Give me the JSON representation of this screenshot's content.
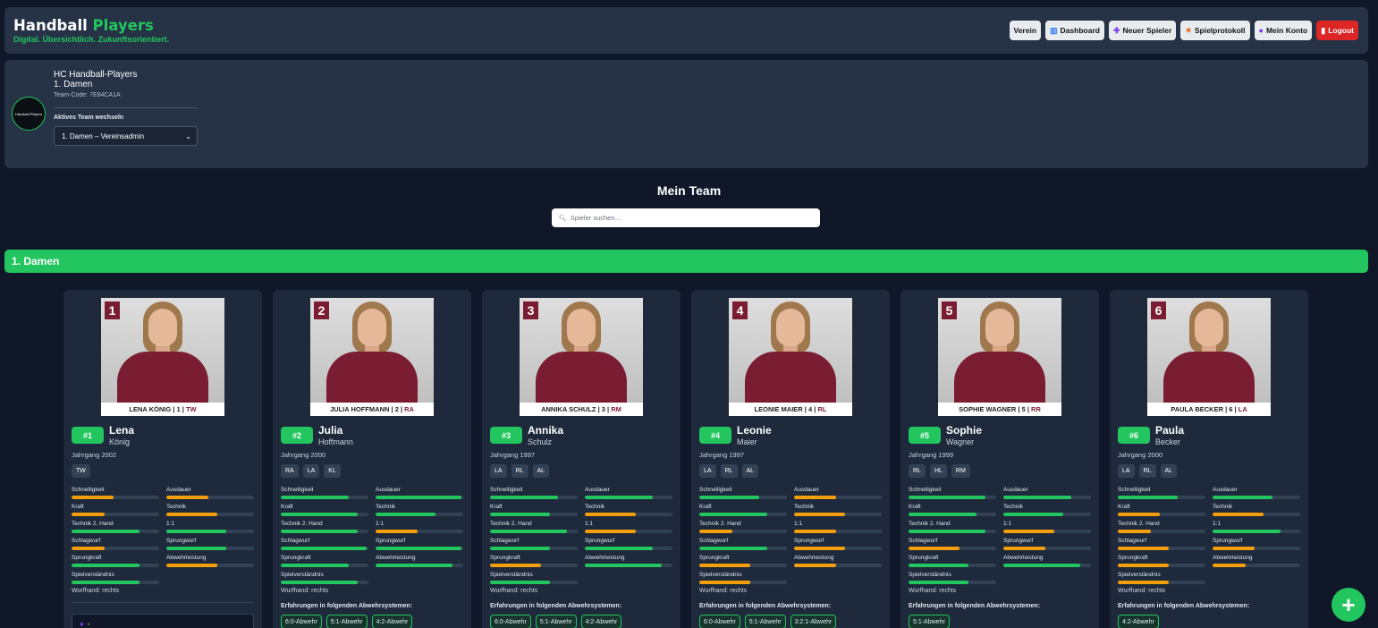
{
  "app": {
    "brand_main": "Handball",
    "brand_accent": "Players",
    "tagline": "Digital. Übersichtlich. Zukunftsorientiert."
  },
  "nav": {
    "verein": "Verein",
    "dashboard": "Dashboard",
    "new_player": "Neuer Spieler",
    "protocol": "Spielprotokoll",
    "account": "Mein Konto",
    "logout": "Logout"
  },
  "team": {
    "club": "HC Handball-Players",
    "name": "1. Damen",
    "code": "Team-Code: 7E84CA1A",
    "switch_label": "Aktives Team wechseln",
    "select_value": "1. Damen – Vereinsadmin",
    "logo_text": "Handball Players"
  },
  "page": {
    "title": "Mein Team",
    "search_placeholder": "Spieler suchen...",
    "group": "1. Damen",
    "fab": "+"
  },
  "stat_labels": [
    "Schnelligkeit",
    "Ausdauer",
    "Kraft",
    "Technik",
    "Technik 2. Hand",
    "1:1",
    "Schlagwurf",
    "Sprungwurf",
    "Sprungkraft",
    "Abwehrleistung",
    "Spielverständnis"
  ],
  "defense_title": "Erfahrungen in folgenden Abwehrsystemen:",
  "colors": {
    "green": "#22c55e",
    "orange": "#f59e0b",
    "maroon": "#7b1d32"
  },
  "players": [
    {
      "photo_num": "1",
      "caption_name": "LENA KÖNIG",
      "caption_num": "1",
      "caption_pos": "TW",
      "badge": "#1",
      "first": "Lena",
      "last": "König",
      "birth": "Jahrgang 2002",
      "tags": [
        "TW"
      ],
      "hand": "Wurfhand: rechts",
      "contact": "-",
      "defenses": [],
      "stats": [
        {
          "v": 0.48,
          "c": "orange"
        },
        {
          "v": 0.48,
          "c": "orange"
        },
        {
          "v": 0.38,
          "c": "orange"
        },
        {
          "v": 0.58,
          "c": "orange"
        },
        {
          "v": 0.78,
          "c": "green"
        },
        {
          "v": 0.68,
          "c": "green"
        },
        {
          "v": 0.38,
          "c": "orange"
        },
        {
          "v": 0.68,
          "c": "green"
        },
        {
          "v": 0.78,
          "c": "green"
        },
        {
          "v": 0.58,
          "c": "orange"
        },
        {
          "v": 0.78,
          "c": "green"
        }
      ]
    },
    {
      "photo_num": "2",
      "caption_name": "JULIA HOFFMANN",
      "caption_num": "2",
      "caption_pos": "RA",
      "badge": "#2",
      "first": "Julia",
      "last": "Hoffmann",
      "birth": "Jahrgang 2000",
      "tags": [
        "RA",
        "LA",
        "KL"
      ],
      "hand": "Wurfhand: rechts",
      "contact": "",
      "defenses": [
        "6:0-Abwehr",
        "5:1-Abwehr",
        "4:2-Abwehr"
      ],
      "stats": [
        {
          "v": 0.78,
          "c": "green"
        },
        {
          "v": 0.98,
          "c": "green"
        },
        {
          "v": 0.88,
          "c": "green"
        },
        {
          "v": 0.68,
          "c": "green"
        },
        {
          "v": 0.88,
          "c": "green"
        },
        {
          "v": 0.48,
          "c": "orange"
        },
        {
          "v": 0.98,
          "c": "green"
        },
        {
          "v": 0.98,
          "c": "green"
        },
        {
          "v": 0.78,
          "c": "green"
        },
        {
          "v": 0.88,
          "c": "green"
        },
        {
          "v": 0.88,
          "c": "green"
        }
      ]
    },
    {
      "photo_num": "3",
      "caption_name": "ANNIKA SCHULZ",
      "caption_num": "3",
      "caption_pos": "RM",
      "badge": "#3",
      "first": "Annika",
      "last": "Schulz",
      "birth": "Jahrgang 1997",
      "tags": [
        "LA",
        "RL",
        "AL"
      ],
      "hand": "Wurfhand: rechts",
      "contact": "",
      "defenses": [
        "6:0-Abwehr",
        "5:1-Abwehr",
        "4:2-Abwehr"
      ],
      "stats": [
        {
          "v": 0.78,
          "c": "green"
        },
        {
          "v": 0.78,
          "c": "green"
        },
        {
          "v": 0.68,
          "c": "green"
        },
        {
          "v": 0.58,
          "c": "orange"
        },
        {
          "v": 0.88,
          "c": "green"
        },
        {
          "v": 0.58,
          "c": "orange"
        },
        {
          "v": 0.68,
          "c": "green"
        },
        {
          "v": 0.78,
          "c": "green"
        },
        {
          "v": 0.58,
          "c": "orange"
        },
        {
          "v": 0.88,
          "c": "green"
        },
        {
          "v": 0.68,
          "c": "green"
        }
      ]
    },
    {
      "photo_num": "4",
      "caption_name": "LEONIE MAIER",
      "caption_num": "4",
      "caption_pos": "RL",
      "badge": "#4",
      "first": "Leonie",
      "last": "Maier",
      "birth": "Jahrgang 1997",
      "tags": [
        "LA",
        "RL",
        "AL"
      ],
      "hand": "Wurfhand: rechts",
      "contact": "",
      "defenses": [
        "6:0-Abwehr",
        "5:1-Abwehr",
        "3:2:1-Abwehr"
      ],
      "stats": [
        {
          "v": 0.68,
          "c": "green"
        },
        {
          "v": 0.48,
          "c": "orange"
        },
        {
          "v": 0.78,
          "c": "green"
        },
        {
          "v": 0.58,
          "c": "orange"
        },
        {
          "v": 0.38,
          "c": "orange"
        },
        {
          "v": 0.48,
          "c": "orange"
        },
        {
          "v": 0.78,
          "c": "green"
        },
        {
          "v": 0.58,
          "c": "orange"
        },
        {
          "v": 0.58,
          "c": "orange"
        },
        {
          "v": 0.48,
          "c": "orange"
        },
        {
          "v": 0.58,
          "c": "orange"
        }
      ]
    },
    {
      "photo_num": "5",
      "caption_name": "SOPHIE WAGNER",
      "caption_num": "5",
      "caption_pos": "RR",
      "badge": "#5",
      "first": "Sophie",
      "last": "Wagner",
      "birth": "Jahrgang 1999",
      "tags": [
        "RL",
        "HL",
        "RM"
      ],
      "hand": "Wurfhand: rechts",
      "contact": "",
      "defenses": [
        "5:1-Abwehr"
      ],
      "stats": [
        {
          "v": 0.88,
          "c": "green"
        },
        {
          "v": 0.78,
          "c": "green"
        },
        {
          "v": 0.78,
          "c": "green"
        },
        {
          "v": 0.68,
          "c": "green"
        },
        {
          "v": 0.88,
          "c": "green"
        },
        {
          "v": 0.58,
          "c": "orange"
        },
        {
          "v": 0.58,
          "c": "orange"
        },
        {
          "v": 0.48,
          "c": "orange"
        },
        {
          "v": 0.68,
          "c": "green"
        },
        {
          "v": 0.88,
          "c": "green"
        },
        {
          "v": 0.68,
          "c": "green"
        }
      ]
    },
    {
      "photo_num": "6",
      "caption_name": "PAULA BECKER",
      "caption_num": "6",
      "caption_pos": "LA",
      "badge": "#6",
      "first": "Paula",
      "last": "Becker",
      "birth": "Jahrgang 2000",
      "tags": [
        "LA",
        "RL",
        "AL"
      ],
      "hand": "Wurfhand: rechts",
      "contact": "",
      "defenses": [
        "4:2-Abwehr"
      ],
      "stats": [
        {
          "v": 0.68,
          "c": "green"
        },
        {
          "v": 0.68,
          "c": "green"
        },
        {
          "v": 0.48,
          "c": "orange"
        },
        {
          "v": 0.58,
          "c": "orange"
        },
        {
          "v": 0.38,
          "c": "orange"
        },
        {
          "v": 0.78,
          "c": "green"
        },
        {
          "v": 0.58,
          "c": "orange"
        },
        {
          "v": 0.48,
          "c": "orange"
        },
        {
          "v": 0.58,
          "c": "orange"
        },
        {
          "v": 0.38,
          "c": "orange"
        },
        {
          "v": 0.58,
          "c": "orange"
        }
      ]
    }
  ]
}
